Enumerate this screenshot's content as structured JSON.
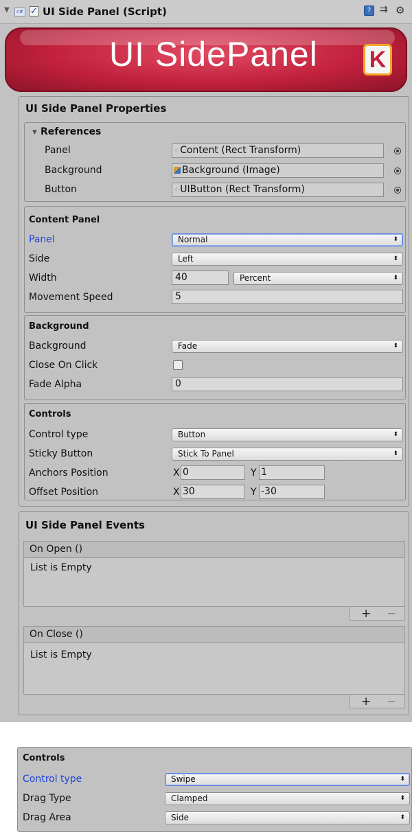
{
  "header": {
    "title": "UI Side Panel (Script)"
  },
  "banner": {
    "text": "UI SidePanel",
    "logo_letter": "K",
    "color": "#c81e3a"
  },
  "properties_title": "UI Side Panel Properties",
  "references": {
    "title": "References",
    "rows": [
      {
        "label": "Panel",
        "value": "Content (Rect Transform)"
      },
      {
        "label": "Background",
        "value": "Background (Image)"
      },
      {
        "label": "Button",
        "value": "UIButton (Rect Transform)"
      }
    ]
  },
  "content_panel": {
    "title": "Content Panel",
    "panel_label": "Panel",
    "panel_value": "Normal",
    "side_label": "Side",
    "side_value": "Left",
    "width_label": "Width",
    "width_value": "40",
    "width_unit": "Percent",
    "speed_label": "Movement Speed",
    "speed_value": "5"
  },
  "background": {
    "title": "Background",
    "bg_label": "Background",
    "bg_value": "Fade",
    "close_label": "Close On Click",
    "close_checked": false,
    "alpha_label": "Fade Alpha",
    "alpha_value": "0"
  },
  "controls": {
    "title": "Controls",
    "type_label": "Control type",
    "type_value": "Button",
    "sticky_label": "Sticky Button",
    "sticky_value": "Stick To Panel",
    "anchors_label": "Anchors Position",
    "anchors_x": "0",
    "anchors_y": "1",
    "offset_label": "Offset Position",
    "offset_x": "30",
    "offset_y": "-30",
    "x_label": "X",
    "y_label": "Y"
  },
  "events": {
    "title": "UI Side Panel Events",
    "open_header": "On Open ()",
    "open_body": "List is Empty",
    "close_header": "On Close ()",
    "close_body": "List is Empty",
    "plus": "+",
    "minus": "−"
  },
  "controls2": {
    "title": "Controls",
    "type_label": "Control type",
    "type_value": "Swipe",
    "drag_type_label": "Drag Type",
    "drag_type_value": "Clamped",
    "drag_area_label": "Drag Area",
    "drag_area_value": "Side"
  }
}
